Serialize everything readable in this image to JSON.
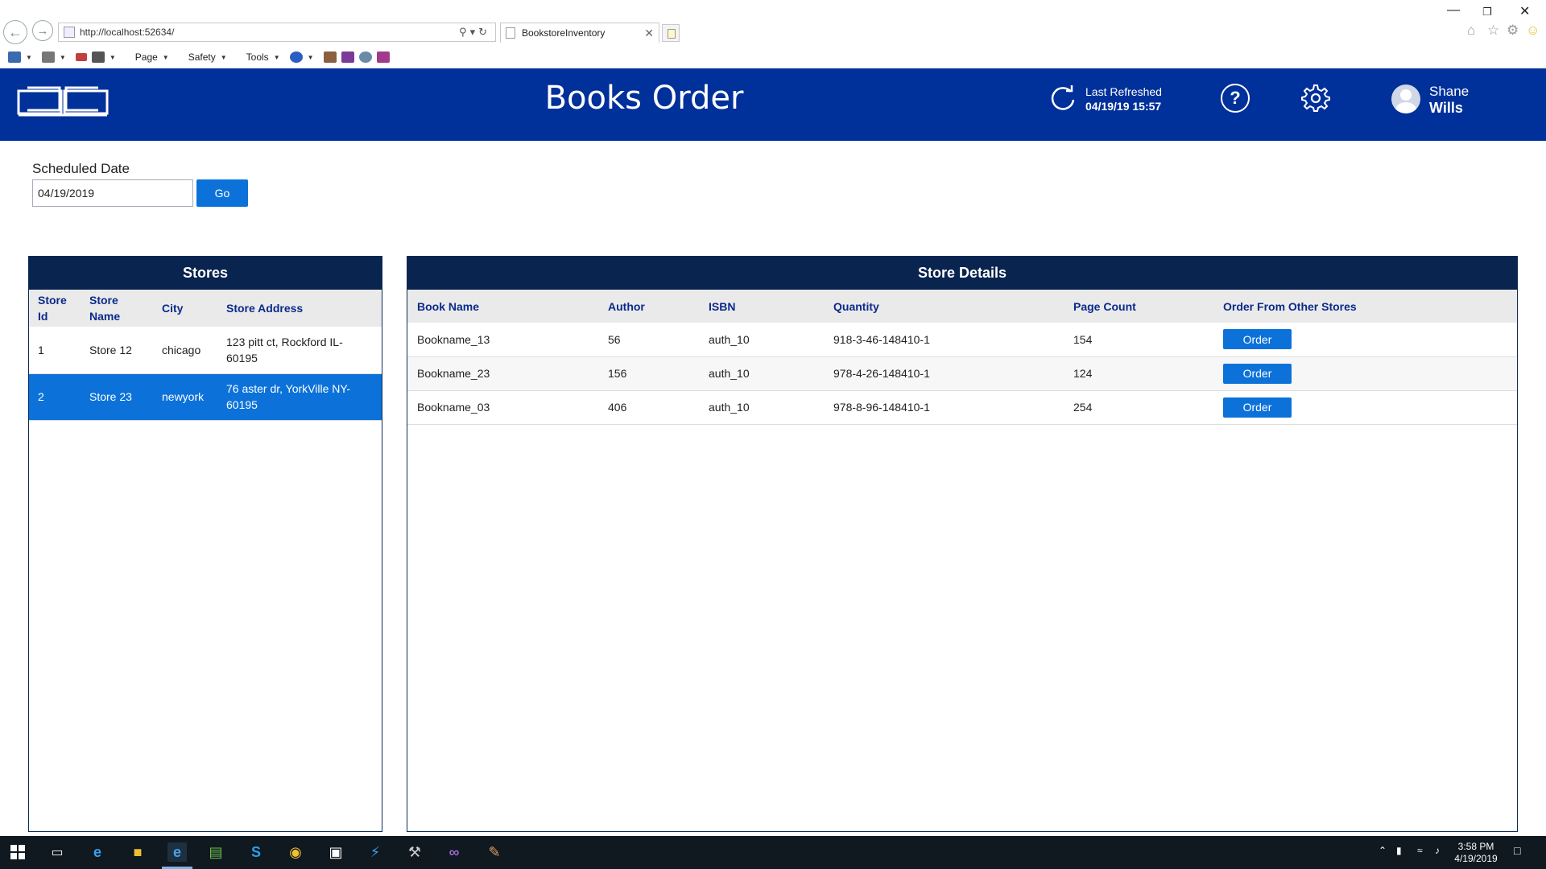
{
  "browser": {
    "url": "http://localhost:52634/",
    "tab_title": "BookstoreInventory",
    "menus": [
      "Page",
      "Safety",
      "Tools"
    ]
  },
  "header": {
    "title": "Books Order",
    "last_refreshed_label": "Last Refreshed",
    "last_refreshed_value": "04/19/19 15:57",
    "user_first": "Shane",
    "user_last": "Wills"
  },
  "form": {
    "date_label": "Scheduled Date",
    "date_value": "04/19/2019",
    "go_label": "Go"
  },
  "stores": {
    "title": "Stores",
    "columns": [
      "Store Id",
      "Store Name",
      "City",
      "Store Address"
    ],
    "rows": [
      {
        "id": "1",
        "name": "Store 12",
        "city": "chicago",
        "address": "123 pitt ct, Rockford IL-60195",
        "selected": false
      },
      {
        "id": "2",
        "name": "Store 23",
        "city": "newyork",
        "address": "76 aster dr, YorkVille NY-60195",
        "selected": true
      }
    ]
  },
  "details": {
    "title": "Store Details",
    "columns": [
      "Book Name",
      "Author",
      "ISBN",
      "Quantity",
      "Page Count",
      "Order From Other Stores"
    ],
    "order_label": "Order",
    "rows": [
      {
        "book": "Bookname_13",
        "author": "56",
        "isbn": "auth_10",
        "quantity": "918-3-46-148410-1",
        "pages": "154"
      },
      {
        "book": "Bookname_23",
        "author": "156",
        "isbn": "auth_10",
        "quantity": "978-4-26-148410-1",
        "pages": "124"
      },
      {
        "book": "Bookname_03",
        "author": "406",
        "isbn": "auth_10",
        "quantity": "978-8-96-148410-1",
        "pages": "254"
      }
    ]
  },
  "taskbar": {
    "time": "3:58 PM",
    "date": "4/19/2019"
  },
  "colors": {
    "header_bg": "#00309a",
    "panel_head_bg": "#0a2450",
    "accent": "#0c72d9"
  }
}
